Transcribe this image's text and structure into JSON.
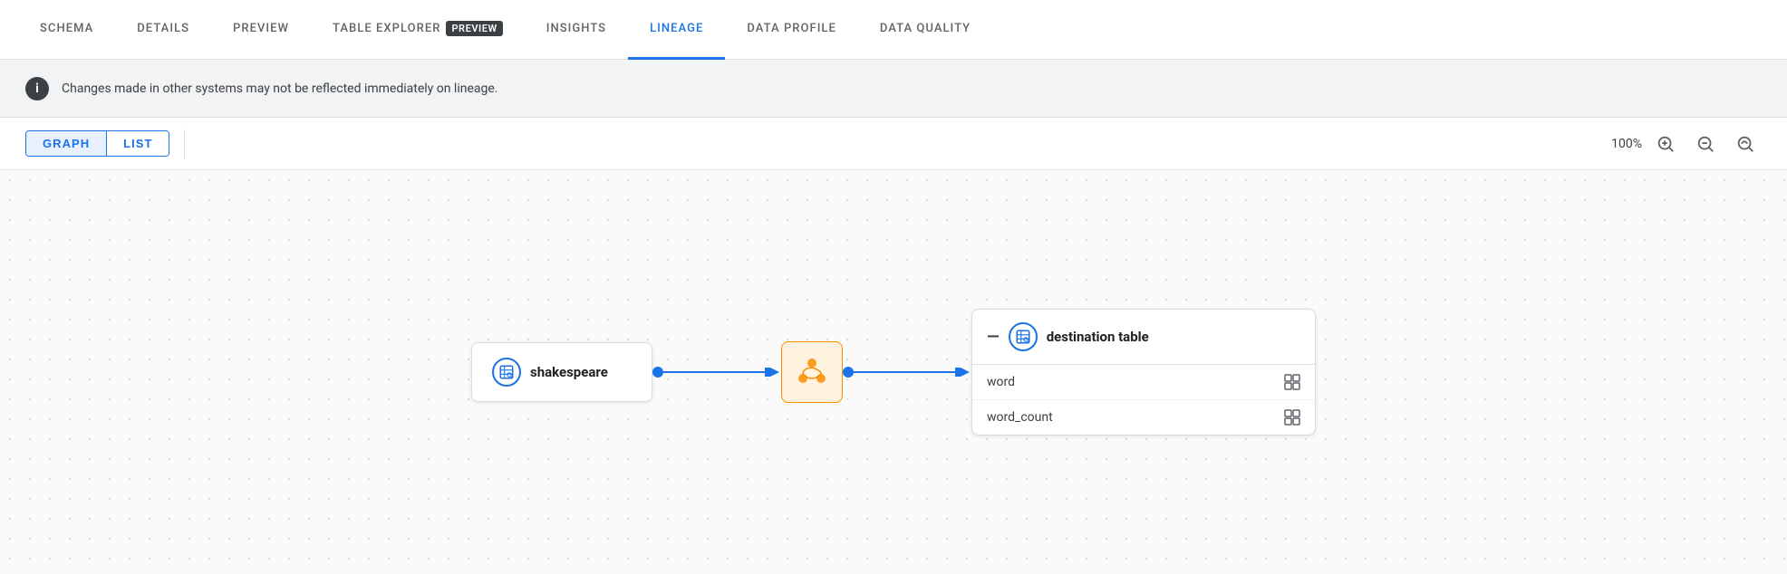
{
  "tabs": [
    {
      "id": "schema",
      "label": "SCHEMA",
      "active": false
    },
    {
      "id": "details",
      "label": "DETAILS",
      "active": false
    },
    {
      "id": "preview",
      "label": "PREVIEW",
      "active": false
    },
    {
      "id": "table-explorer",
      "label": "TABLE EXPLORER",
      "badge": "PREVIEW",
      "active": false
    },
    {
      "id": "insights",
      "label": "INSIGHTS",
      "active": false
    },
    {
      "id": "lineage",
      "label": "LINEAGE",
      "active": true
    },
    {
      "id": "data-profile",
      "label": "DATA PROFILE",
      "active": false
    },
    {
      "id": "data-quality",
      "label": "DATA QUALITY",
      "active": false
    }
  ],
  "banner": {
    "text": "Changes made in other systems may not be reflected immediately on lineage."
  },
  "view_controls": {
    "graph_label": "GRAPH",
    "list_label": "LIST",
    "zoom_percent": "100%"
  },
  "graph": {
    "source_node": {
      "label": "shakespeare"
    },
    "destination_node": {
      "label": "destination table",
      "fields": [
        {
          "name": "word"
        },
        {
          "name": "word_count"
        }
      ]
    }
  }
}
